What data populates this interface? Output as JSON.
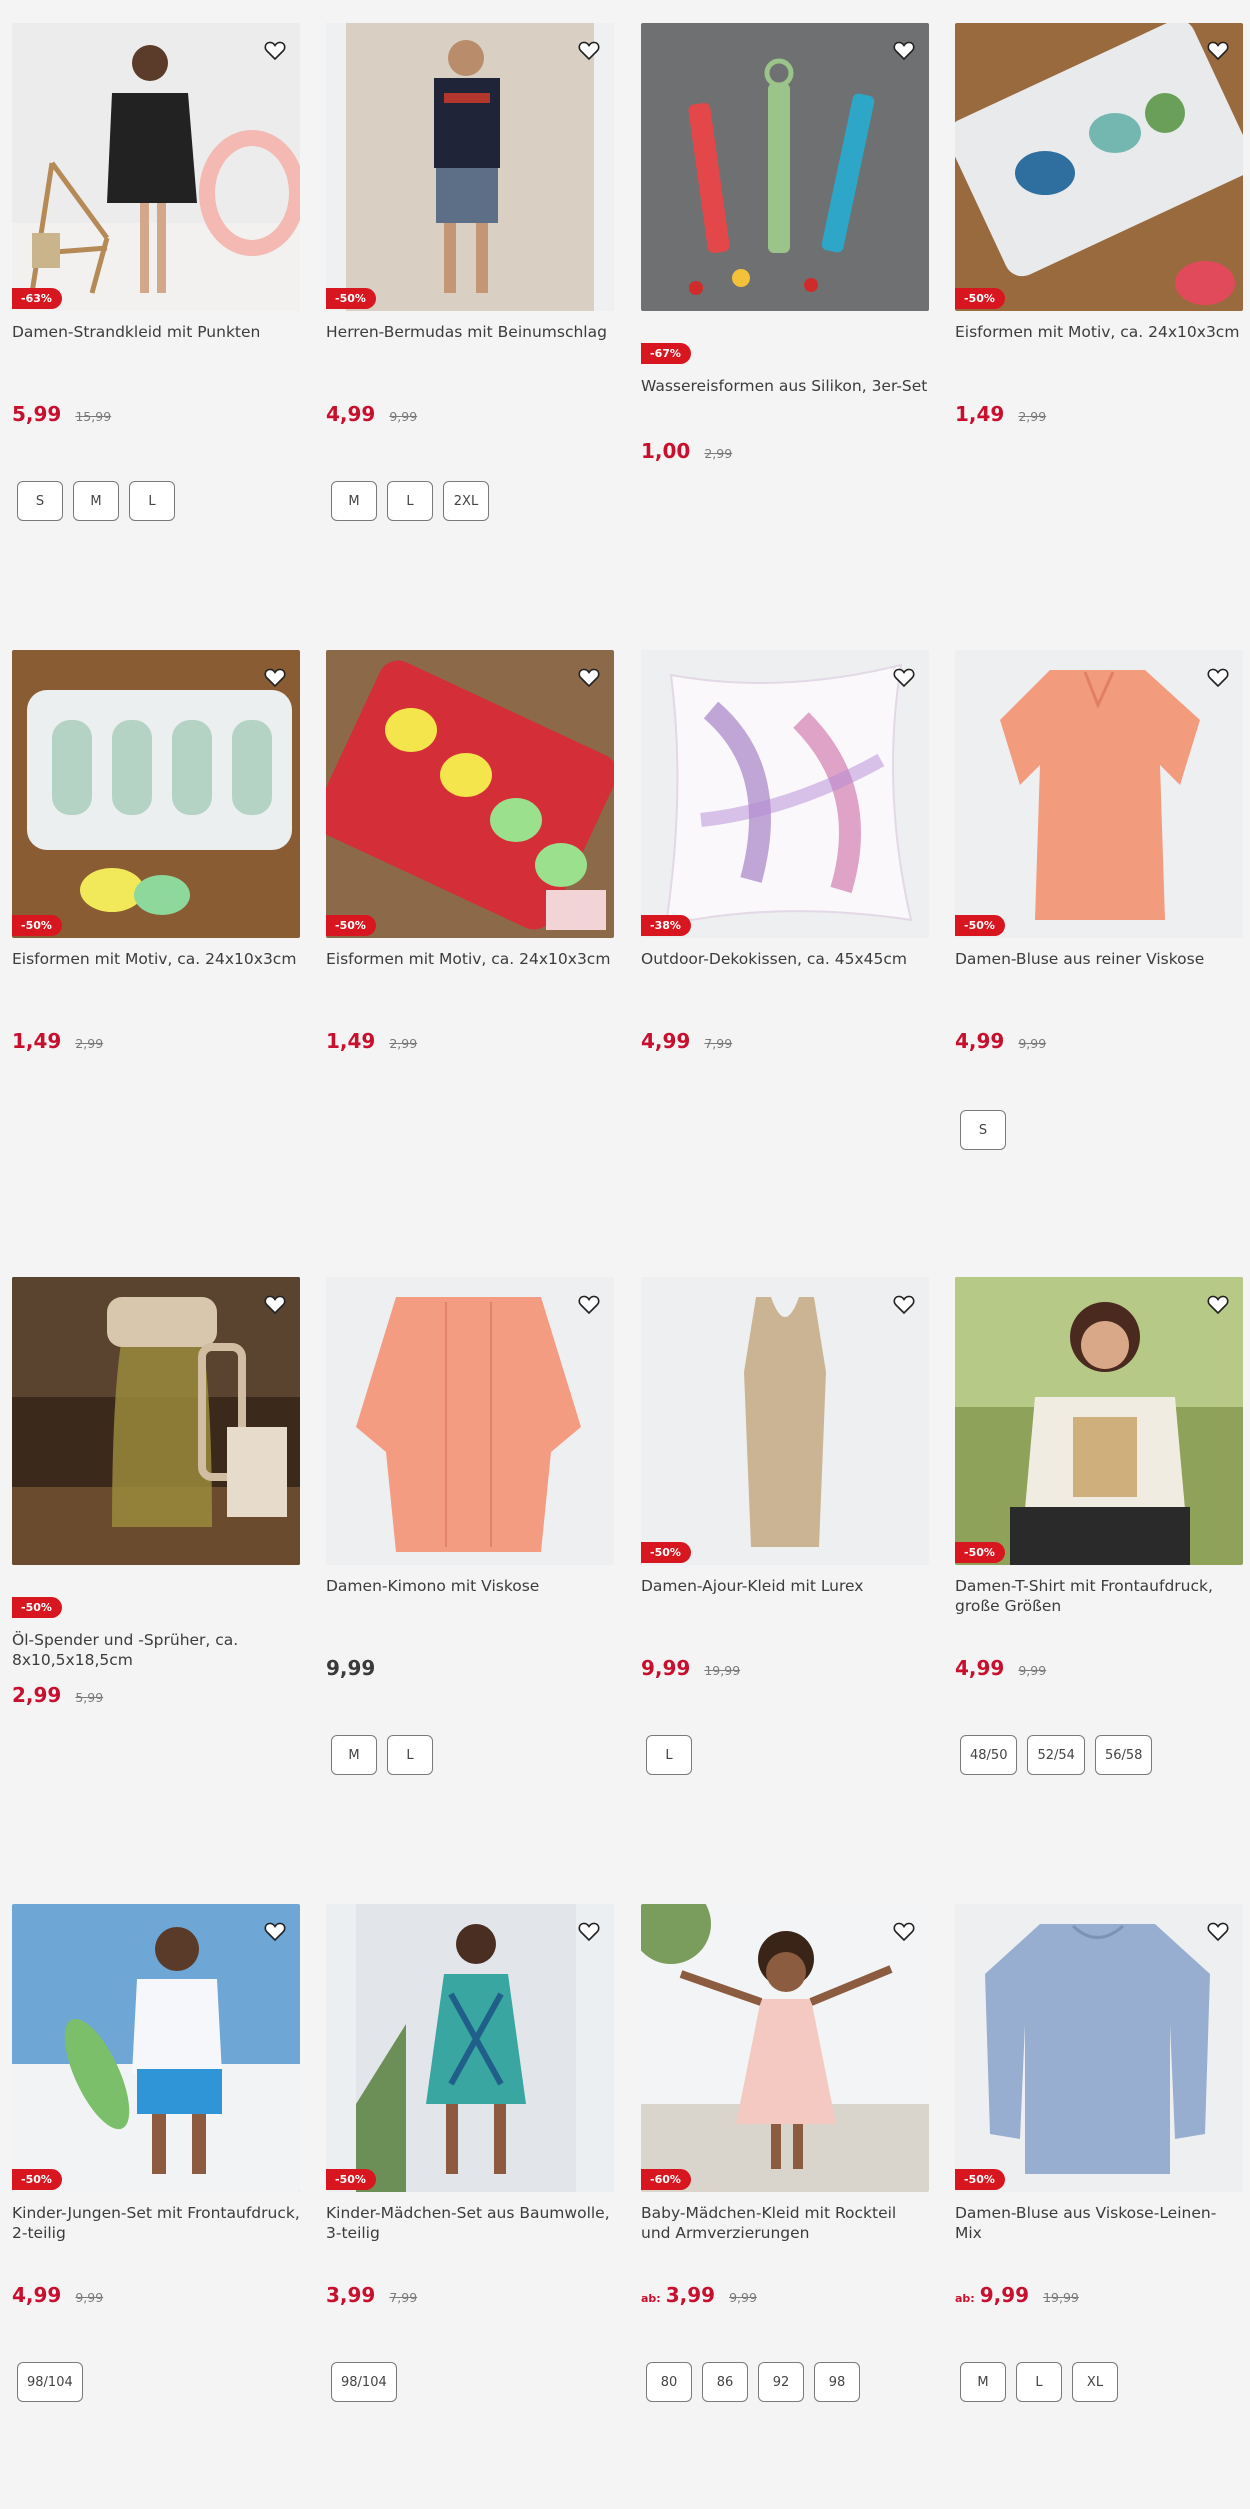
{
  "colors": {
    "sale": "#d7161f",
    "price_sale": "#c8102e",
    "price_normal": "#3a3a3a"
  },
  "products": [
    {
      "name": "Damen-Strandkleid mit Punkten",
      "discount": "-63%",
      "price": "5,99",
      "old": "15,99",
      "sizes": [
        "S",
        "M",
        "L"
      ]
    },
    {
      "name": "Herren-Bermudas mit Beinumschlag",
      "discount": "-50%",
      "price": "4,99",
      "old": "9,99",
      "sizes": [
        "M",
        "L",
        "2XL"
      ]
    },
    {
      "name": "Wassereisformen aus Silikon, 3er-Set",
      "discount": "-67%",
      "price": "1,00",
      "old": "2,99",
      "sizes": []
    },
    {
      "name": "Eisformen mit Motiv, ca. 24x10x3cm",
      "discount": "-50%",
      "price": "1,49",
      "old": "2,99",
      "sizes": []
    },
    {
      "name": "Eisformen mit Motiv, ca. 24x10x3cm",
      "discount": "-50%",
      "price": "1,49",
      "old": "2,99",
      "sizes": []
    },
    {
      "name": "Eisformen mit Motiv, ca. 24x10x3cm",
      "discount": "-50%",
      "price": "1,49",
      "old": "2,99",
      "sizes": []
    },
    {
      "name": "Outdoor-Dekokissen, ca. 45x45cm",
      "discount": "-38%",
      "price": "4,99",
      "old": "7,99",
      "sizes": []
    },
    {
      "name": "Damen-Bluse aus reiner Viskose",
      "discount": "-50%",
      "price": "4,99",
      "old": "9,99",
      "sizes": [
        "S"
      ]
    },
    {
      "name": "Öl-Spender und -Sprüher, ca. 8x10,5x18,5cm",
      "discount": "-50%",
      "price": "2,99",
      "old": "5,99",
      "sizes": []
    },
    {
      "name": "Damen-Kimono mit Viskose",
      "discount": "",
      "price": "9,99",
      "old": "",
      "sizes": [
        "M",
        "L"
      ]
    },
    {
      "name": "Damen-Ajour-Kleid mit Lurex",
      "discount": "-50%",
      "price": "9,99",
      "old": "19,99",
      "sizes": [
        "L"
      ]
    },
    {
      "name": "Damen-T-Shirt mit Frontaufdruck, große Größen",
      "discount": "-50%",
      "price": "4,99",
      "old": "9,99",
      "sizes": [
        "48/50",
        "52/54",
        "56/58"
      ]
    },
    {
      "name": "Kinder-Jungen-Set mit Frontaufdruck, 2-teilig",
      "discount": "-50%",
      "price": "4,99",
      "old": "9,99",
      "sizes": [
        "98/104"
      ]
    },
    {
      "name": "Kinder-Mädchen-Set aus Baumwolle, 3-teilig",
      "discount": "-50%",
      "price": "3,99",
      "old": "7,99",
      "sizes": [
        "98/104"
      ]
    },
    {
      "name": "Baby-Mädchen-Kleid mit Rockteil und Armverzierungen",
      "discount": "-60%",
      "price": "3,99",
      "old": "9,99",
      "prefix": "ab:",
      "sizes": [
        "80",
        "86",
        "92",
        "98"
      ]
    },
    {
      "name": "Damen-Bluse aus Viskose-Leinen-Mix",
      "discount": "-50%",
      "price": "9,99",
      "old": "19,99",
      "prefix": "ab:",
      "sizes": [
        "M",
        "L",
        "XL"
      ]
    }
  ]
}
